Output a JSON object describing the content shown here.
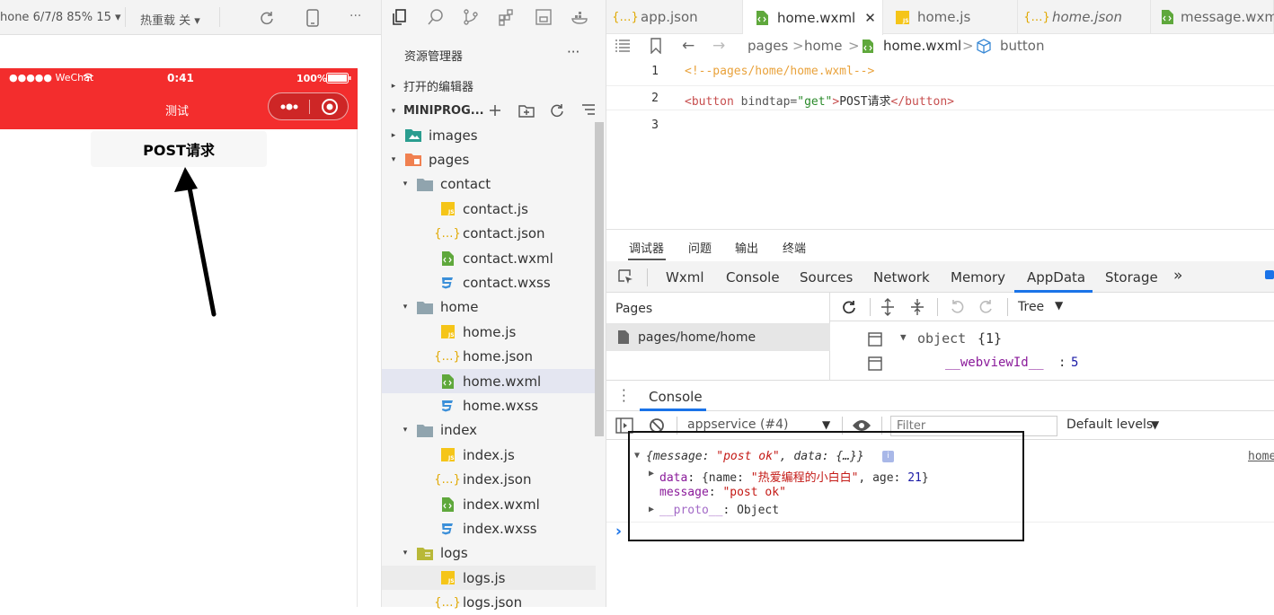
{
  "simulator": {
    "toolbar": {
      "device": "hone 6/7/8 85% 15 ▾",
      "hot_reload": "热重载 关 ▾"
    },
    "statusbar": {
      "carrier": "●●●●● WeChat",
      "time": "0:41",
      "battery": "100%"
    },
    "navbar": {
      "title": "测试"
    },
    "page": {
      "button_label": "POST请求"
    }
  },
  "explorer": {
    "title": "资源管理器",
    "more": "···",
    "open_editors": "打开的编辑器",
    "project": "MINIPROG...",
    "tree": [
      {
        "label": "images",
        "type": "folder-img",
        "depth": 1,
        "caret": "▸"
      },
      {
        "label": "pages",
        "type": "folder-pages",
        "depth": 1,
        "caret": "▾"
      },
      {
        "label": "contact",
        "type": "folder",
        "depth": 2,
        "caret": "▾"
      },
      {
        "label": "contact.js",
        "type": "js",
        "depth": 3
      },
      {
        "label": "contact.json",
        "type": "json",
        "depth": 3
      },
      {
        "label": "contact.wxml",
        "type": "wxml",
        "depth": 3
      },
      {
        "label": "contact.wxss",
        "type": "wxss",
        "depth": 3
      },
      {
        "label": "home",
        "type": "folder",
        "depth": 2,
        "caret": "▾"
      },
      {
        "label": "home.js",
        "type": "js",
        "depth": 3
      },
      {
        "label": "home.json",
        "type": "json",
        "depth": 3
      },
      {
        "label": "home.wxml",
        "type": "wxml",
        "depth": 3,
        "selected": true
      },
      {
        "label": "home.wxss",
        "type": "wxss",
        "depth": 3
      },
      {
        "label": "index",
        "type": "folder",
        "depth": 2,
        "caret": "▾"
      },
      {
        "label": "index.js",
        "type": "js",
        "depth": 3
      },
      {
        "label": "index.json",
        "type": "json",
        "depth": 3
      },
      {
        "label": "index.wxml",
        "type": "wxml",
        "depth": 3
      },
      {
        "label": "index.wxss",
        "type": "wxss",
        "depth": 3
      },
      {
        "label": "logs",
        "type": "folder-logs",
        "depth": 2,
        "caret": "▾"
      },
      {
        "label": "logs.js",
        "type": "js",
        "depth": 3,
        "hover": true
      },
      {
        "label": "logs.json",
        "type": "json",
        "depth": 3
      }
    ]
  },
  "editor": {
    "tabs": [
      {
        "label": "app.json",
        "type": "json"
      },
      {
        "label": "home.wxml",
        "type": "wxml",
        "active": true
      },
      {
        "label": "home.js",
        "type": "js"
      },
      {
        "label": "home.json",
        "type": "json",
        "italic": true
      },
      {
        "label": "message.wxm",
        "type": "wxml"
      }
    ],
    "close_glyph": "✕",
    "breadcrumb": {
      "a": "pages",
      "b": "home",
      "c": "home.wxml",
      "d": "button",
      "sep": ">"
    },
    "lines": [
      {
        "num": "1",
        "comment": "<!--pages/home/home.wxml-->"
      },
      {
        "num": "2",
        "open": "<button",
        "attr": " bindtap=",
        "val": "\"get\"",
        "gt": ">",
        "text": "POST请求",
        "close": "</button>"
      },
      {
        "num": "3"
      }
    ]
  },
  "devtools": {
    "top_tabs": [
      "调试器",
      "问题",
      "输出",
      "终端"
    ],
    "tabs": [
      "Wxml",
      "Console",
      "Sources",
      "Network",
      "Memory",
      "AppData",
      "Storage"
    ],
    "more_tabs": "»",
    "pages_header": "Pages",
    "pages_item": "pages/home/home",
    "appdata": {
      "view": "Tree",
      "object": "object",
      "count": "{1}",
      "key": "__webviewId__",
      "colon": ":",
      "value": "5"
    },
    "console": {
      "tab": "Console",
      "context": "appservice (#4)",
      "filter_placeholder": "Filter",
      "levels": "Default levels",
      "source": "home",
      "summary_open": "{message: ",
      "summary_msg": "\"post ok\"",
      "summary_mid": ", data: {…}}",
      "data_key": "data",
      "data_open": ": {name: ",
      "data_name": "\"热爱编程的小白白\"",
      "data_mid": ", age: ",
      "data_age": "21",
      "data_close": "}",
      "msg_key": "message",
      "msg_colon": ": ",
      "msg_val": "\"post ok\"",
      "proto_key": "__proto__",
      "proto_val": ": Object",
      "prompt": "›"
    }
  },
  "colors": {
    "accent_red": "#f32d2d",
    "selection": "#e4e6f1",
    "devtools_blue": "#1a73e8"
  }
}
